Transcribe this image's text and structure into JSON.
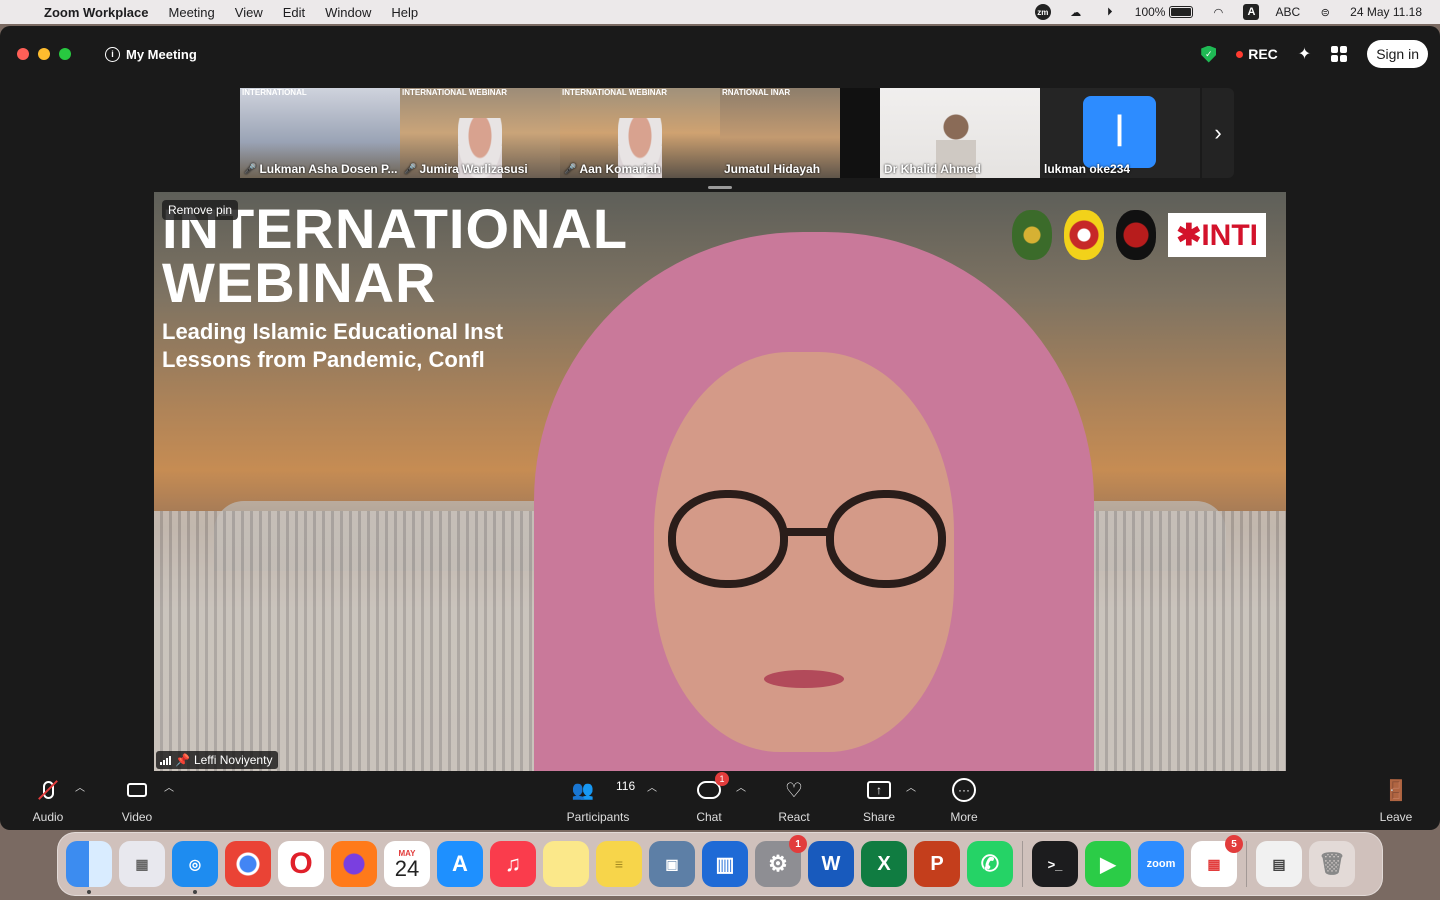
{
  "menubar": {
    "app_name": "Zoom Workplace",
    "items": [
      "Meeting",
      "View",
      "Edit",
      "Window",
      "Help"
    ],
    "status": {
      "zoom_badge": "zm",
      "battery": "100%",
      "input_source": "ABC",
      "datetime": "24 May  11.18"
    }
  },
  "window": {
    "meeting_title": "My Meeting",
    "rec_label": "REC",
    "sign_in_label": "Sign in"
  },
  "thumbnails": [
    {
      "name": "Lukman Asha Dosen P...",
      "muted": true,
      "label": "INTERNATIONAL"
    },
    {
      "name": "Jumira Warlizasusi",
      "muted": true,
      "label": "INTERNATIONAL WEBINAR"
    },
    {
      "name": "Aan Komariah",
      "muted": true,
      "label": "INTERNATIONAL WEBINAR"
    },
    {
      "name": "Jumatul Hidayah",
      "muted": false,
      "label": "RNATIONAL INAR"
    },
    {
      "name": "Dr Khalid Ahmed",
      "muted": false,
      "label": ""
    },
    {
      "name": "lukman oke234",
      "muted": false,
      "avatar_letter": "l"
    }
  ],
  "main_video": {
    "remove_pin_label": "Remove pin",
    "title_line1": "INTERNATIONAL",
    "title_line2": "WEBINAR",
    "subtitle_line1": "Leading Islamic Educational Inst",
    "subtitle_line2": "Lessons from Pandemic, Confl",
    "logo_text": "✱INTI",
    "speaker_name": "Leffi Noviyenty"
  },
  "toolbar": {
    "audio": "Audio",
    "video": "Video",
    "participants": "Participants",
    "participants_count": "116",
    "chat": "Chat",
    "chat_badge": "1",
    "react": "React",
    "share": "Share",
    "more": "More",
    "leave": "Leave"
  },
  "dock": {
    "calendar_month": "MAY",
    "calendar_day": "24",
    "settings_badge": "1",
    "office_badge": "5",
    "zoom_label": "zoom",
    "word_label": "W",
    "excel_label": "X",
    "ppt_label": "P"
  },
  "colors": {
    "accent_blue": "#2d8cff",
    "rec_red": "#ff3b30",
    "shield_green": "#1fb954",
    "window_bg": "#1a1a1a"
  }
}
